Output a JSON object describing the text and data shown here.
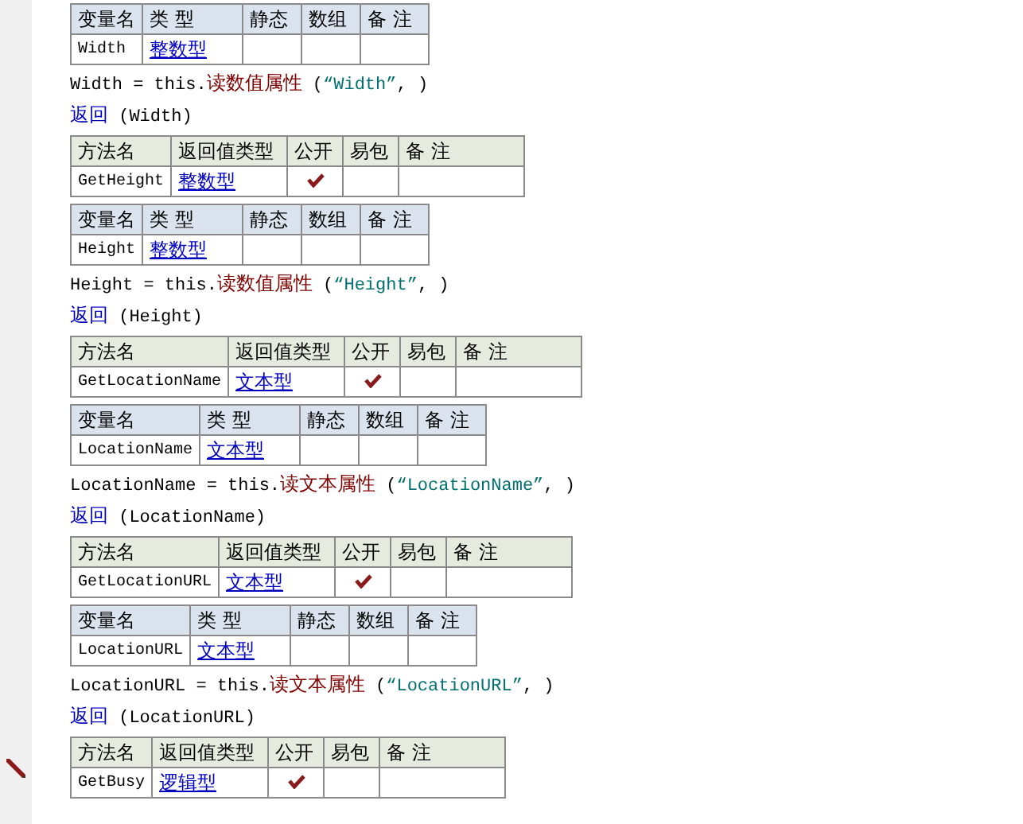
{
  "blocks": [
    {
      "kind": "variable",
      "columns": [
        "变量名",
        "类 型",
        "静态",
        "数组",
        "备 注"
      ],
      "name": "Width",
      "type": "整数型",
      "static": false,
      "array": false
    },
    {
      "kind": "code",
      "segments": [
        {
          "kind": "plain",
          "t": "Width = this."
        },
        {
          "kind": "call",
          "t": "读数值属性"
        },
        {
          "kind": "plain",
          "t": " ("
        },
        {
          "kind": "string",
          "t": "“Width”"
        },
        {
          "kind": "plain",
          "t": ", )"
        }
      ]
    },
    {
      "kind": "code",
      "segments": [
        {
          "kind": "keyword",
          "t": "返回"
        },
        {
          "kind": "plain",
          "t": " (Width)"
        }
      ]
    },
    {
      "kind": "method",
      "columns": [
        "方法名",
        "返回值类型",
        "公开",
        "易包",
        "备 注"
      ],
      "name": "GetHeight",
      "type": "整数型",
      "public": true,
      "easy_pkg": false
    },
    {
      "kind": "variable",
      "columns": [
        "变量名",
        "类 型",
        "静态",
        "数组",
        "备 注"
      ],
      "name": "Height",
      "type": "整数型",
      "static": false,
      "array": false
    },
    {
      "kind": "code",
      "segments": [
        {
          "kind": "plain",
          "t": "Height = this."
        },
        {
          "kind": "call",
          "t": "读数值属性"
        },
        {
          "kind": "plain",
          "t": " ("
        },
        {
          "kind": "string",
          "t": "“Height”"
        },
        {
          "kind": "plain",
          "t": ", )"
        }
      ]
    },
    {
      "kind": "code",
      "segments": [
        {
          "kind": "keyword",
          "t": "返回"
        },
        {
          "kind": "plain",
          "t": " (Height)"
        }
      ]
    },
    {
      "kind": "method",
      "columns": [
        "方法名",
        "返回值类型",
        "公开",
        "易包",
        "备 注"
      ],
      "name": "GetLocationName",
      "type": "文本型",
      "public": true,
      "easy_pkg": false
    },
    {
      "kind": "variable",
      "columns": [
        "变量名",
        "类 型",
        "静态",
        "数组",
        "备 注"
      ],
      "name": "LocationName",
      "type": "文本型",
      "static": false,
      "array": false
    },
    {
      "kind": "code",
      "segments": [
        {
          "kind": "plain",
          "t": "LocationName = this."
        },
        {
          "kind": "call",
          "t": "读文本属性"
        },
        {
          "kind": "plain",
          "t": " ("
        },
        {
          "kind": "string",
          "t": "“LocationName”"
        },
        {
          "kind": "plain",
          "t": ", )"
        }
      ]
    },
    {
      "kind": "code",
      "segments": [
        {
          "kind": "keyword",
          "t": "返回"
        },
        {
          "kind": "plain",
          "t": " (LocationName)"
        }
      ]
    },
    {
      "kind": "method",
      "columns": [
        "方法名",
        "返回值类型",
        "公开",
        "易包",
        "备 注"
      ],
      "name": "GetLocationURL",
      "type": "文本型",
      "public": true,
      "easy_pkg": false
    },
    {
      "kind": "variable",
      "columns": [
        "变量名",
        "类 型",
        "静态",
        "数组",
        "备 注"
      ],
      "name": "LocationURL",
      "type": "文本型",
      "static": false,
      "array": false
    },
    {
      "kind": "code",
      "segments": [
        {
          "kind": "plain",
          "t": "LocationURL = this."
        },
        {
          "kind": "call",
          "t": "读文本属性"
        },
        {
          "kind": "plain",
          "t": " ("
        },
        {
          "kind": "string",
          "t": "“LocationURL”"
        },
        {
          "kind": "plain",
          "t": ", )"
        }
      ]
    },
    {
      "kind": "code",
      "segments": [
        {
          "kind": "keyword",
          "t": "返回"
        },
        {
          "kind": "plain",
          "t": " (LocationURL)"
        }
      ]
    },
    {
      "kind": "method",
      "columns": [
        "方法名",
        "返回值类型",
        "公开",
        "易包",
        "备 注"
      ],
      "name": "GetBusy",
      "type": "逻辑型",
      "public": true,
      "easy_pkg": false,
      "current": true
    }
  ]
}
